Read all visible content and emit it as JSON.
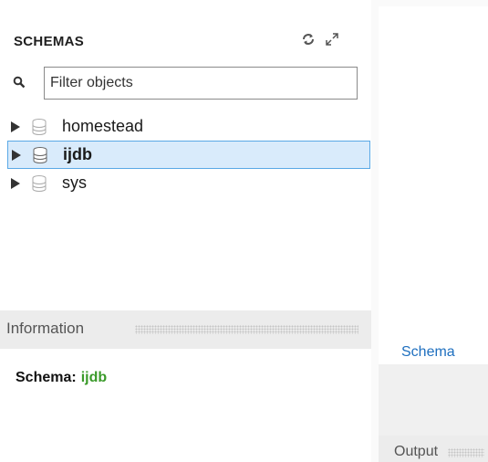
{
  "sidebar": {
    "title": "SCHEMAS",
    "header_icons": [
      "refresh-icon",
      "expand-icon"
    ],
    "filter_placeholder": "Filter objects",
    "schemas": [
      {
        "label": "homestead",
        "selected": false
      },
      {
        "label": "ijdb",
        "selected": true
      },
      {
        "label": "sys",
        "selected": false
      }
    ]
  },
  "info": {
    "title": "Information",
    "schema_key": "Schema:",
    "schema_value": "ijdb",
    "value_color": "#3a9a2a"
  },
  "right": {
    "tab_label": "Schema",
    "output_label": "Output"
  },
  "colors": {
    "selection_bg": "#d9ebfb",
    "selection_border": "#5aa9e6",
    "link_blue": "#1e6fbf"
  }
}
